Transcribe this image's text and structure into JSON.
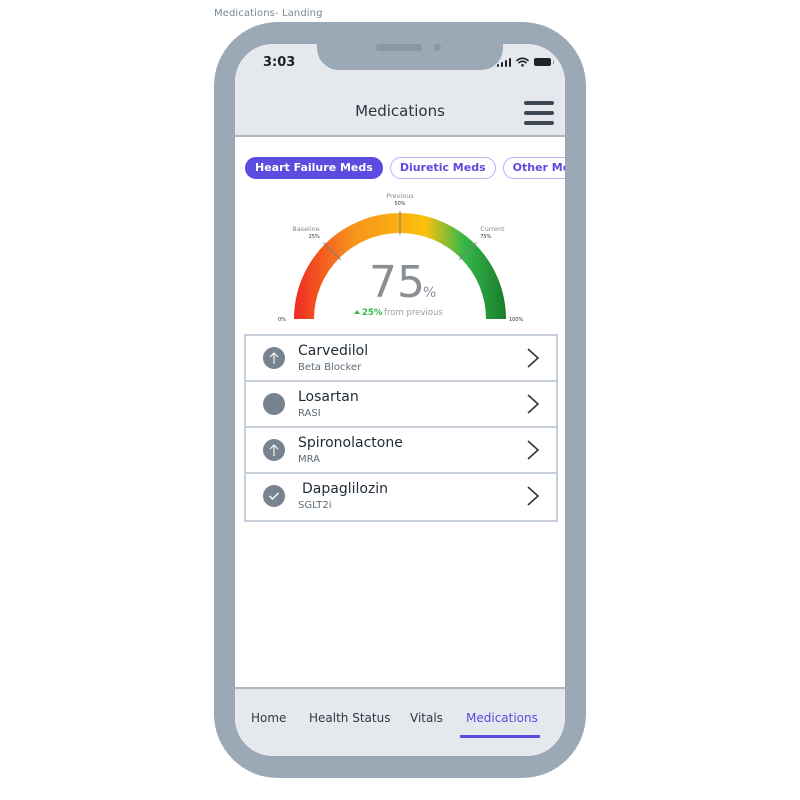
{
  "frame_label": "Medications- Landing",
  "status_bar": {
    "time": "3:03",
    "icons": [
      "signal-icon",
      "wifi-icon",
      "battery-icon"
    ]
  },
  "header": {
    "title": "Medications",
    "menu_icon": "hamburger-menu-icon"
  },
  "tabs": [
    {
      "label": "Heart Failure Meds",
      "active": true
    },
    {
      "label": "Diuretic Meds",
      "active": false
    },
    {
      "label": "Other Meds",
      "active": false
    }
  ],
  "gauge": {
    "value_percent": 75,
    "value_display": "75",
    "unit": "%",
    "change_text": "25%",
    "change_suffix": "from previous",
    "change_direction": "up",
    "change_color": "#2dbb4e",
    "min_label": "0%",
    "max_label": "100%",
    "markers": [
      {
        "name": "Baseline",
        "value_label": "25%",
        "value": 25
      },
      {
        "name": "Previous",
        "value_label": "50%",
        "value": 50
      },
      {
        "name": "Current",
        "value_label": "75%",
        "value": 75
      }
    ],
    "gradient_colors": [
      "#ef2a23",
      "#f7941d",
      "#fbc10b",
      "#35b84a",
      "#1a7c2c"
    ]
  },
  "medications": [
    {
      "name": "Carvedilol",
      "class": "Beta Blocker",
      "status_icon": "arrow-up-icon"
    },
    {
      "name": "Losartan",
      "class": "RASI",
      "status_icon": "empty-circle-icon"
    },
    {
      "name": "Spironolactone",
      "class": "MRA",
      "status_icon": "arrow-up-icon"
    },
    {
      "name": "Dapaglilozin",
      "class": "SGLT2i",
      "status_icon": "checkmark-icon"
    }
  ],
  "bottom_nav": [
    {
      "label": "Home",
      "active": false
    },
    {
      "label": "Health Status",
      "active": false
    },
    {
      "label": "Vitals",
      "active": false
    },
    {
      "label": "Medications",
      "active": true
    }
  ],
  "colors": {
    "accent": "#5b4be0",
    "frame": "#9aa9b5",
    "header_bg": "#e5e8ec",
    "icon_gray": "#77838f"
  }
}
